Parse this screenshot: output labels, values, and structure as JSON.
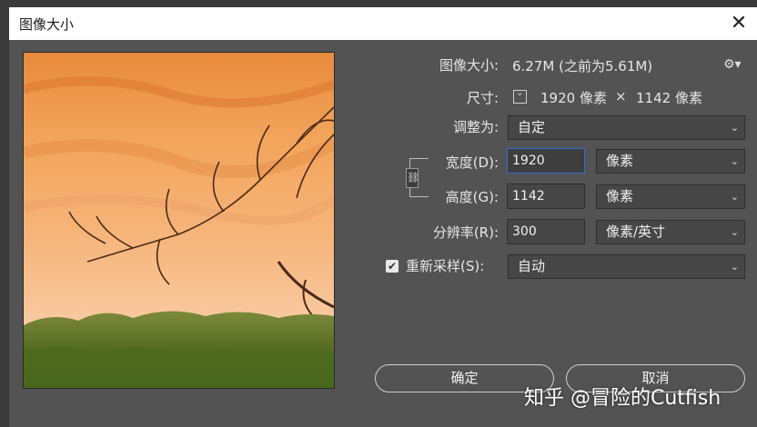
{
  "dialog": {
    "title": "图像大小",
    "close_glyph": "✕",
    "settings_glyph": "⚙▾"
  },
  "image_size": {
    "label": "图像大小:",
    "value": "6.27M (之前为5.61M)"
  },
  "dimensions": {
    "label": "尺寸:",
    "width_text": "1920 像素",
    "times": "×",
    "height_text": "1142 像素"
  },
  "fit_to": {
    "label": "调整为:",
    "value": "自定"
  },
  "width": {
    "label": "宽度(D):",
    "value": "1920",
    "unit": "像素"
  },
  "height": {
    "label": "高度(G):",
    "value": "1142",
    "unit": "像素"
  },
  "resolution": {
    "label": "分辨率(R):",
    "value": "300",
    "unit": "像素/英寸"
  },
  "resample": {
    "label": "重新采样(S):",
    "checked": true,
    "value": "自动"
  },
  "buttons": {
    "ok": "确定",
    "cancel": "取消"
  },
  "watermark": "知乎 @冒险的Cutfish",
  "colors": {
    "dialog_bg": "#535353",
    "titlebar_bg": "#ffffff",
    "focus_border": "#2f6fd6"
  }
}
